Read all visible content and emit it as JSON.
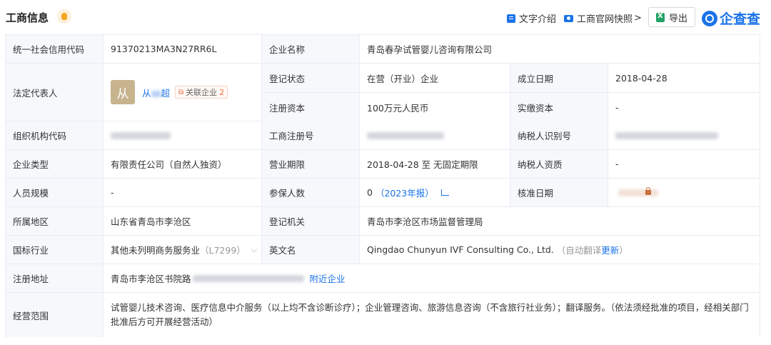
{
  "header": {
    "title": "工商信息",
    "text_intro": "文字介绍",
    "snapshot": "工商官网快照",
    "snapshot_arrow": ">",
    "export": "导出",
    "brand": "企查查"
  },
  "icons": {
    "badge": "bell-badge-icon",
    "doc": "doc-icon",
    "camera": "camera-icon",
    "excel": "excel-icon",
    "brand": "qcc-logo-icon",
    "lock": "lock-icon",
    "chart": "chart-icon",
    "chevron": "chevron-down-icon"
  },
  "labels": {
    "credit_code": "统一社会信用代码",
    "company_name": "企业名称",
    "legal_rep": "法定代表人",
    "reg_status": "登记状态",
    "est_date": "成立日期",
    "reg_capital": "注册资本",
    "paid_capital": "实缴资本",
    "org_code": "组织机构代码",
    "biz_reg_no": "工商注册号",
    "taxpayer_id": "纳税人识别号",
    "company_type": "企业类型",
    "biz_term": "营业期限",
    "taxpayer_qual": "纳税人资质",
    "staff_size": "人员规模",
    "insured": "参保人数",
    "approval_date": "核准日期",
    "region": "所属地区",
    "reg_authority": "登记机关",
    "industry": "国标行业",
    "english_name": "英文名",
    "reg_address": "注册地址",
    "biz_scope": "经营范围"
  },
  "values": {
    "credit_code": "91370213MA3N27RR6L",
    "company_name": "青岛春孕试管婴儿咨询有限公司",
    "legal_rep_avatar": "从",
    "legal_rep_name_first": "从",
    "legal_rep_name_last": "超",
    "related_label": "关联企业",
    "related_count": "2",
    "reg_status": "在营（开业）企业",
    "est_date": "2018-04-28",
    "reg_capital": "100万元人民币",
    "paid_capital": "-",
    "company_type": "有限责任公司（自然人独资）",
    "biz_term": "2018-04-28 至 无固定期限",
    "taxpayer_qual": "-",
    "staff_size": "-",
    "insured_count": "0",
    "insured_year": "（2023年报）",
    "region": "山东省青岛市李沧区",
    "reg_authority": "青岛市李沧区市场监督管理局",
    "industry": "其他未列明商务服务业",
    "industry_code": "（L7299）",
    "english_name": "Qingdao Chunyun IVF Consulting Co., Ltd.",
    "auto_translate_open": "（自动翻译",
    "update": "更新",
    "auto_translate_close": "）",
    "address_prefix": "青岛市李沧区书院路",
    "nearby": "附近企业",
    "biz_scope": "试管婴儿技术咨询、医疗信息中介服务（以上均不含诊断诊疗）；企业管理咨询、旅游信息咨询（不含旅行社业务）；翻译服务。（依法须经批准的项目，经相关部门批准后方可开展经营活动）"
  }
}
